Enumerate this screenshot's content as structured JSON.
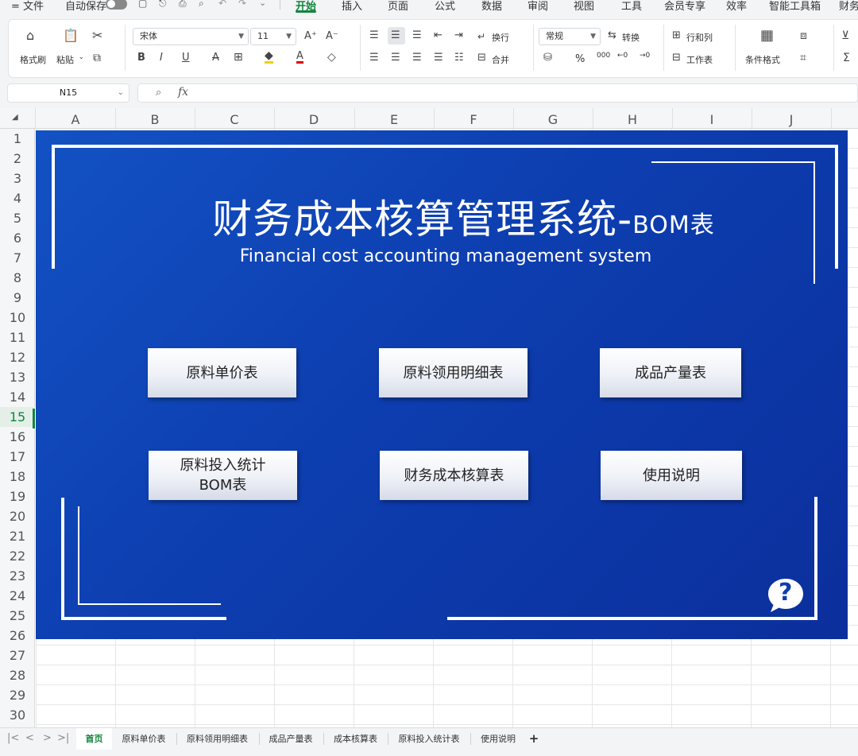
{
  "menu": {
    "items": [
      "= 文件",
      "自动保存",
      "开始",
      "插入",
      "页面",
      "公式",
      "数据",
      "审阅",
      "视图",
      "工具",
      "会员专享",
      "效率",
      "智能工具箱",
      "财务"
    ],
    "active": "开始"
  },
  "ribbon": {
    "format_painter": "格式刷",
    "paste": "粘贴",
    "font_name": "宋体",
    "font_size": "11",
    "wrap": "换行",
    "merge": "合并",
    "number_format": "常规",
    "convert": "转换",
    "row_col": "行和列",
    "worksheet": "工作表",
    "cond_format": "条件格式",
    "bold": "B",
    "italic": "I",
    "underline": "U",
    "font_color_letter": "A",
    "percent": "%",
    "thousands": "000"
  },
  "formula_bar": {
    "cell_ref": "N15",
    "fx": "fx",
    "content": ""
  },
  "columns": [
    "A",
    "B",
    "C",
    "D",
    "E",
    "F",
    "G",
    "H",
    "I",
    "J"
  ],
  "rows": [
    "1",
    "2",
    "3",
    "4",
    "5",
    "6",
    "7",
    "8",
    "9",
    "10",
    "11",
    "12",
    "13",
    "14",
    "15",
    "16",
    "17",
    "18",
    "19",
    "20",
    "21",
    "22",
    "23",
    "24",
    "25",
    "26",
    "27",
    "28",
    "29",
    "30"
  ],
  "selected_row": "15",
  "dashboard": {
    "title_main": "财务成本核算管理系统-",
    "title_suffix": "BOM表",
    "subtitle": "Financial cost accounting management system",
    "buttons": [
      "原料单价表",
      "原料领用明细表",
      "成品产量表",
      "原料投入统计\nBOM表",
      "财务成本核算表",
      "使用说明"
    ],
    "help_glyph": "?",
    "bg_color": "#0d3eb0",
    "line_color": "#ffffff"
  },
  "sheet_tabs": {
    "tabs": [
      "首页",
      "原料单价表",
      "原料领用明细表",
      "成品产量表",
      "成本核算表",
      "原料投入统计表",
      "使用说明"
    ],
    "active": "首页",
    "add": "+"
  },
  "accent_color": "#13853d"
}
